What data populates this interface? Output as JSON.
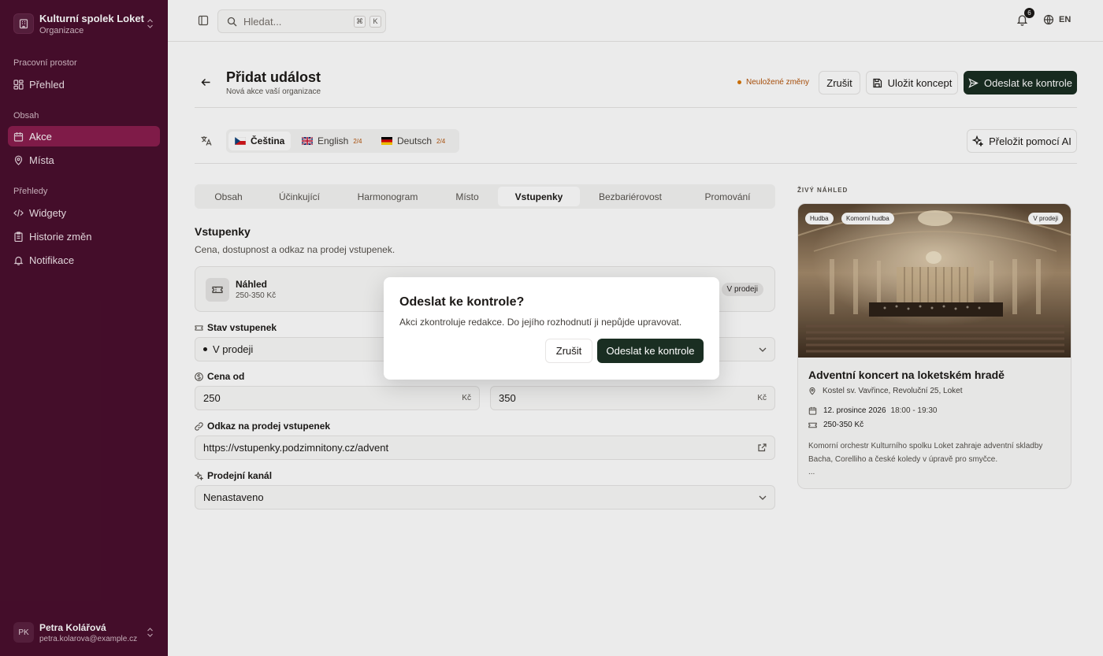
{
  "sidebar": {
    "org_name": "Kulturní spolek Loket",
    "org_sub": "Organizace",
    "sections": [
      {
        "label": "Pracovní prostor"
      },
      {
        "label": "Obsah"
      },
      {
        "label": "Přehledy"
      }
    ],
    "items": [
      {
        "label": "Přehled",
        "icon": "dashboard-icon"
      },
      {
        "label": "Akce",
        "icon": "calendar-icon",
        "active": true
      },
      {
        "label": "Místa",
        "icon": "map-pin-icon"
      },
      {
        "label": "Widgety",
        "icon": "code-icon"
      },
      {
        "label": "Historie změn",
        "icon": "clipboard-icon"
      },
      {
        "label": "Notifikace",
        "icon": "bell-icon"
      }
    ],
    "user": {
      "initials": "PK",
      "name": "Petra Kolářová",
      "email": "petra.kolarova@example.cz"
    }
  },
  "topbar": {
    "search_placeholder": "Hledat...",
    "kbd_1": "⌘",
    "kbd_2": "K",
    "notification_count": "6",
    "language": "EN"
  },
  "header": {
    "title": "Přidat událost",
    "subtitle": "Nová akce vaší organizace",
    "unsaved": "Neuložené změny",
    "cancel": "Zrušit",
    "save_draft": "Uložit koncept",
    "submit": "Odeslat ke kontrole"
  },
  "lang_tabs": [
    {
      "label": "Čeština",
      "count": ""
    },
    {
      "label": "English",
      "count": "2/4"
    },
    {
      "label": "Deutsch",
      "count": "2/4"
    }
  ],
  "ai_translate": "Přeložit pomocí AI",
  "section_tabs": [
    "Obsah",
    "Účinkující",
    "Harmonogram",
    "Místo",
    "Vstupenky",
    "Bezbariérovost",
    "Promování"
  ],
  "active_section": "Vstupenky",
  "form": {
    "title": "Vstupenky",
    "subtitle": "Cena, dostupnost a odkaz na prodej vstupenek.",
    "preview": {
      "title": "Náhled",
      "price": "250-350 Kč",
      "badge": "V prodeji"
    },
    "status_label": "Stav vstupenek",
    "status_value": "V prodeji",
    "price_from_label": "Cena od",
    "price_from": "250",
    "price_to": "350",
    "currency": "Kč",
    "link_label": "Odkaz na prodej vstupenek",
    "link_value": "https://vstupenky.podzimnitony.cz/advent",
    "channel_label": "Prodejní kanál",
    "channel_value": "Nenastaveno"
  },
  "live_preview": {
    "label": "ŽIVÝ NÁHLED",
    "tags": [
      "Hudba",
      "Komorní hudba"
    ],
    "status": "V prodeji",
    "title": "Adventní koncert na loketském hradě",
    "venue": "Kostel sv. Vavřince, Revoluční 25, Loket",
    "date": "12. prosince 2026",
    "time": "18:00 - 19:30",
    "price": "250-350 Kč",
    "description": "Komorní orchestr Kulturního spolku Loket zahraje adventní skladby Bacha, Corelliho a české koledy v úpravě pro smyčce.",
    "more": "..."
  },
  "modal": {
    "title": "Odeslat ke kontrole?",
    "text": "Akci zkontroluje redakce. Do jejího rozhodnutí ji nepůjde upravovat.",
    "cancel": "Zrušit",
    "confirm": "Odeslat ke kontrole"
  },
  "colors": {
    "sidebar_bg": "#4a0f2e",
    "active_nav": "#8a1e4f",
    "primary_button": "#1a2e22",
    "unsaved_text": "#b45309"
  }
}
